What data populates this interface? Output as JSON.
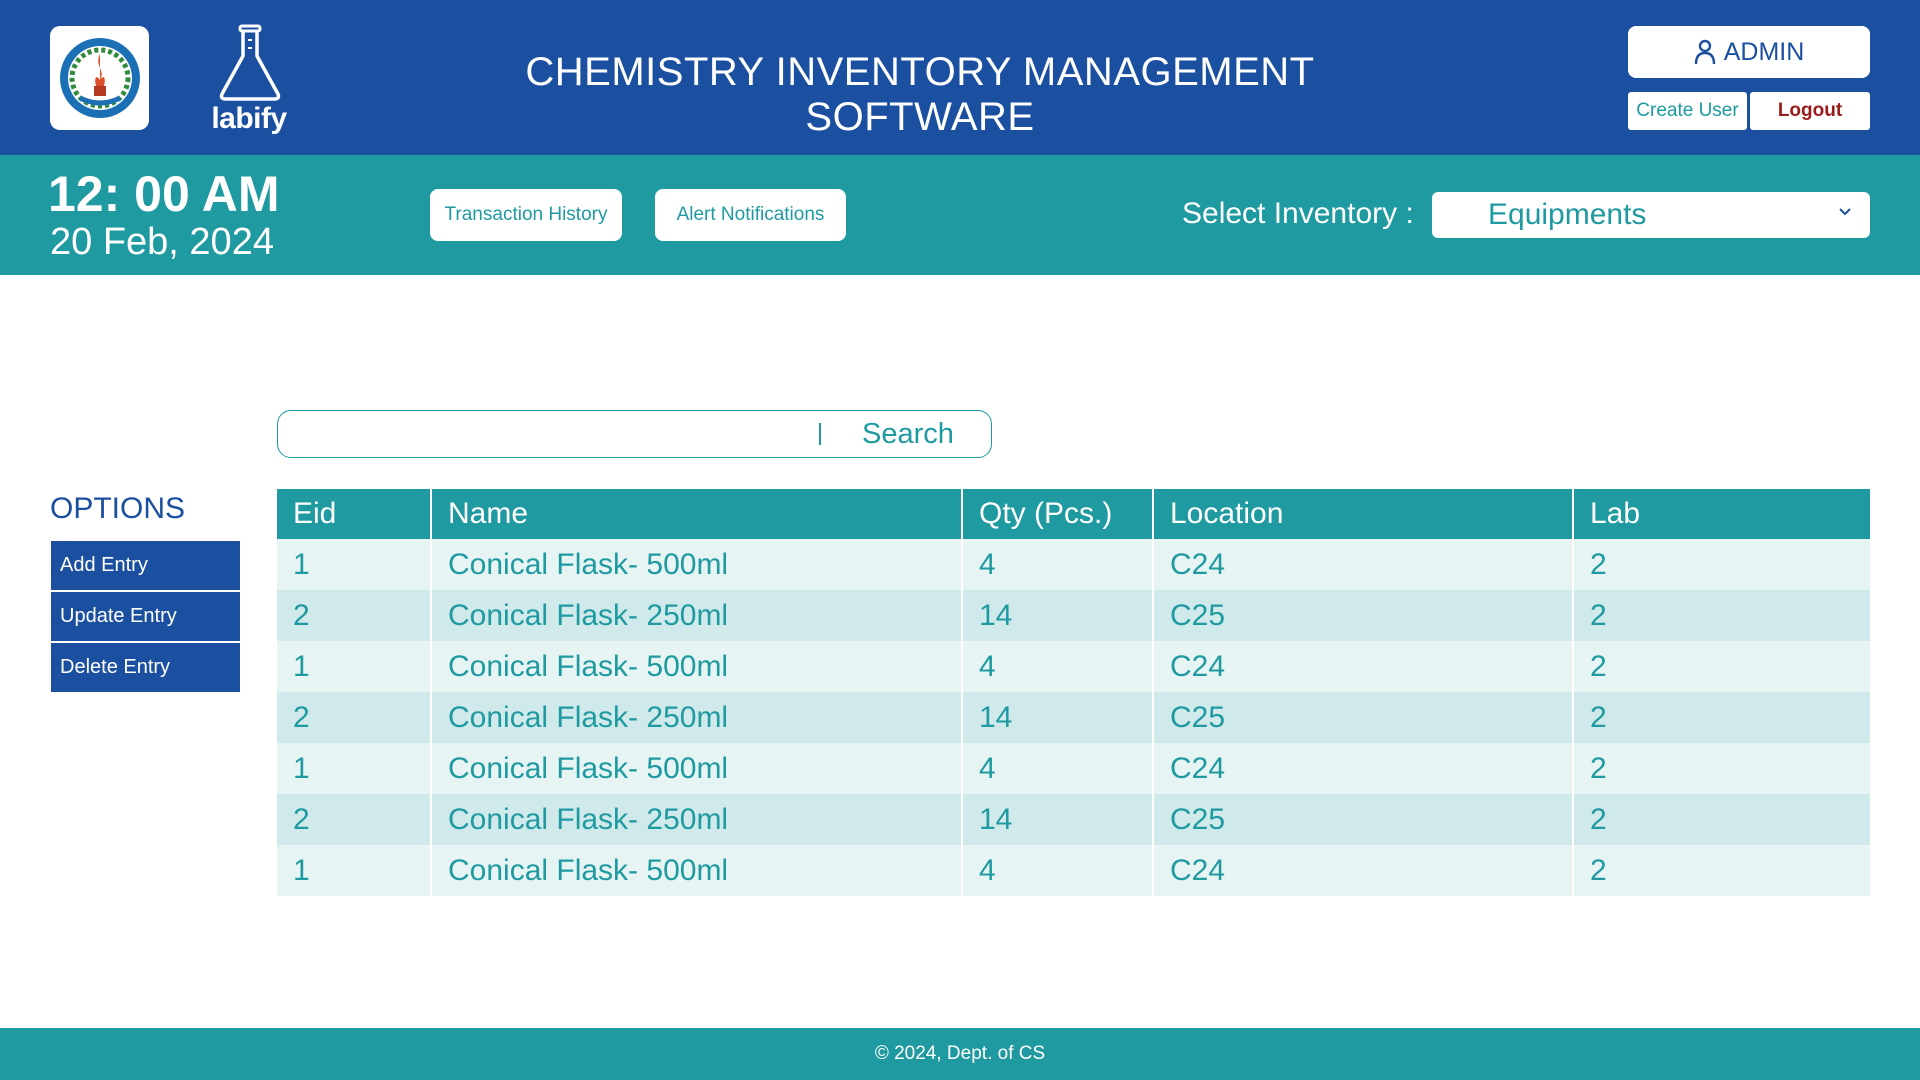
{
  "header": {
    "app_title": "CHEMISTRY INVENTORY MANAGEMENT SOFTWARE",
    "brand_name": "labify",
    "college_logo_icon": "college-emblem-icon",
    "flask_icon": "flask-icon",
    "admin_label": "ADMIN",
    "create_user_label": "Create User",
    "logout_label": "Logout",
    "colors": {
      "primary": "#1b4fa0",
      "accent": "#1e9aa0",
      "logout": "#9a1a1a"
    }
  },
  "subbar": {
    "time": "12: 00 AM",
    "date": "20 Feb, 2024",
    "transaction_history_label": "Transaction History",
    "alert_notifications_label": "Alert Notifications",
    "select_inventory_label": "Select Inventory :",
    "selected_inventory": "Equipments"
  },
  "search": {
    "value": "",
    "button_label": "Search"
  },
  "options": {
    "title": "OPTIONS",
    "add_label": "Add Entry",
    "update_label": "Update Entry",
    "delete_label": "Delete Entry"
  },
  "table": {
    "headers": [
      "Eid",
      "Name",
      "Qty (Pcs.)",
      "Location",
      "Lab"
    ],
    "rows": [
      [
        "1",
        "Conical Flask- 500ml",
        "4",
        "C24",
        "2"
      ],
      [
        "2",
        "Conical Flask- 250ml",
        "14",
        "C25",
        "2"
      ],
      [
        "1",
        "Conical Flask- 500ml",
        "4",
        "C24",
        "2"
      ],
      [
        "2",
        "Conical Flask- 250ml",
        "14",
        "C25",
        "2"
      ],
      [
        "1",
        "Conical Flask- 500ml",
        "4",
        "C24",
        "2"
      ],
      [
        "2",
        "Conical Flask- 250ml",
        "14",
        "C25",
        "2"
      ],
      [
        "1",
        "Conical Flask- 500ml",
        "4",
        "C24",
        "2"
      ]
    ]
  },
  "footer": {
    "text": "© 2024, Dept. of CS"
  }
}
